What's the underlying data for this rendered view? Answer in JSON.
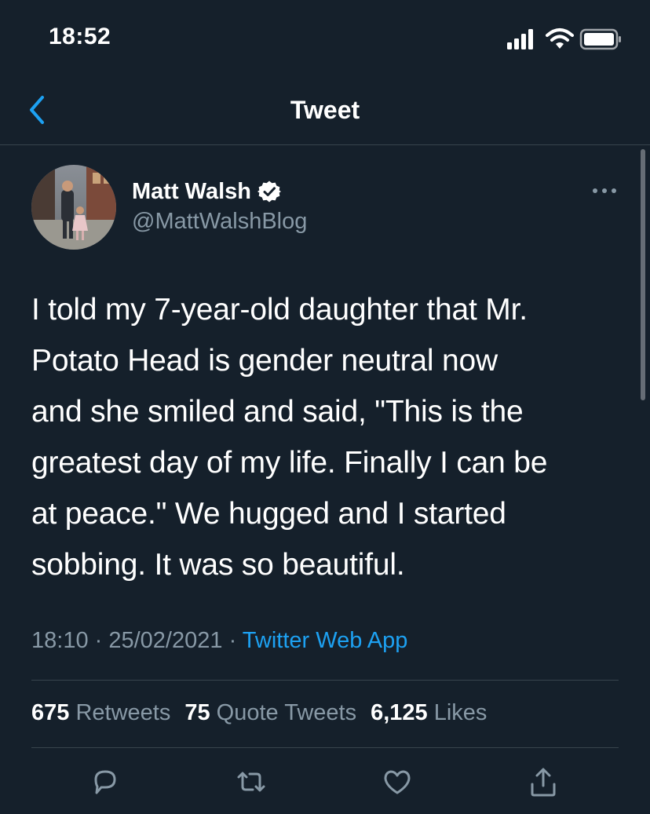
{
  "status_bar": {
    "time": "18:52"
  },
  "nav": {
    "title": "Tweet"
  },
  "tweet": {
    "author": {
      "name": "Matt Walsh",
      "handle": "@MattWalshBlog",
      "verified": true
    },
    "text": "I told my 7-year-old daughter that Mr.\nPotato Head is gender neutral now\nand she smiled and said, \"This is the\ngreatest day of my life. Finally I can be\nat peace.\" We hugged and I started\nsobbing. It was so beautiful.",
    "time": "18:10",
    "separator": " · ",
    "date": "25/02/2021",
    "source": "Twitter Web App",
    "stats": {
      "retweets_count": "675",
      "retweets_label": "Retweets",
      "quote_tweets_count": "75",
      "quote_tweets_label": "Quote Tweets",
      "likes_count": "6,125",
      "likes_label": "Likes"
    }
  },
  "icons": {
    "back": "chevron-left-icon",
    "verified": "verified-badge-icon",
    "more": "more-horizontal-icon",
    "reply": "reply-icon",
    "retweet": "retweet-icon",
    "like": "heart-icon",
    "share": "share-icon"
  },
  "colors": {
    "background": "#15202b",
    "accent": "#1da1f2",
    "secondary_text": "#8899a6",
    "divider": "#38444d"
  }
}
